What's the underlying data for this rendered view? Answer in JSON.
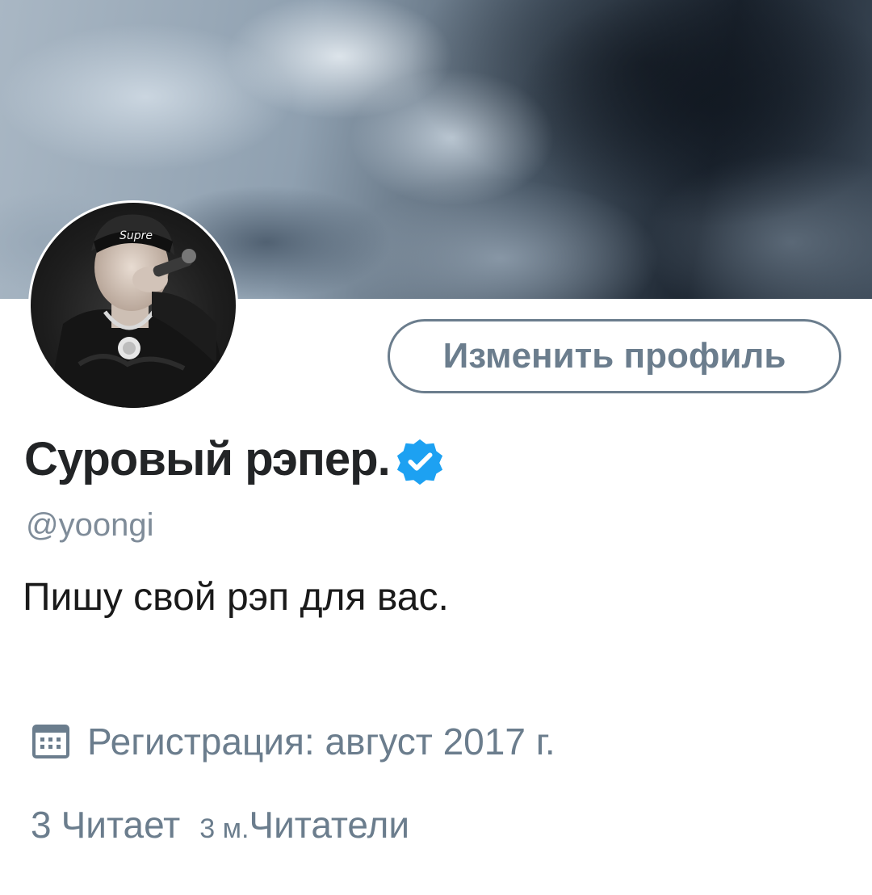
{
  "profile": {
    "display_name": "Суровый рэпер.",
    "handle": "@yoongi",
    "bio": "Пишу свой рэп для вас.",
    "verified": true,
    "edit_button_label": "Изменить профиль",
    "join_label": "Регистрация: август 2017 г."
  },
  "stats": {
    "following_count": "3",
    "following_label": "Читает",
    "followers_count": "3 м.",
    "followers_label": "Читатели"
  },
  "icons": {
    "verified": "verified-badge-icon",
    "calendar": "calendar-icon"
  },
  "colors": {
    "verified_blue": "#1DA1F2",
    "secondary_text": "#6b7d8d",
    "primary_text": "#222426"
  }
}
